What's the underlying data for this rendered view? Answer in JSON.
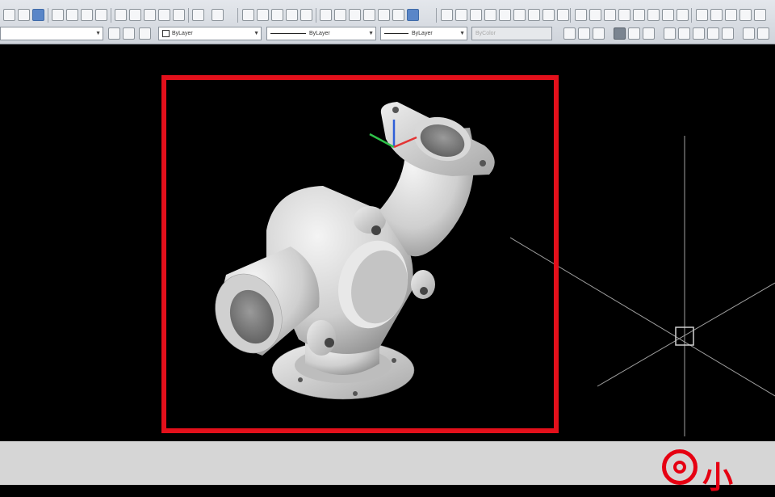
{
  "app": {
    "name": "CAD application"
  },
  "properties": {
    "color": "ByLayer",
    "linetype": "ByLayer",
    "lineweight": "ByLayer",
    "plotstyle": "ByColor"
  },
  "canvas": {
    "background": "#000000",
    "selection_color": "#e3101b"
  },
  "watermark": {
    "text": "小",
    "color": "#e60012"
  },
  "icons": [
    "new-icon",
    "open-icon",
    "save-icon",
    "print-icon",
    "preview-icon",
    "publish-icon",
    "cut-icon",
    "copy-icon",
    "paste-icon",
    "match-icon",
    "undo-icon",
    "redo-icon",
    "pan-icon",
    "zoom-realtime-icon",
    "zoom-window-icon",
    "zoom-previous-icon",
    "properties-icon",
    "design-center-icon",
    "tool-palette-icon",
    "sheet-set-icon",
    "markup-icon",
    "calculator-icon",
    "help-icon"
  ]
}
